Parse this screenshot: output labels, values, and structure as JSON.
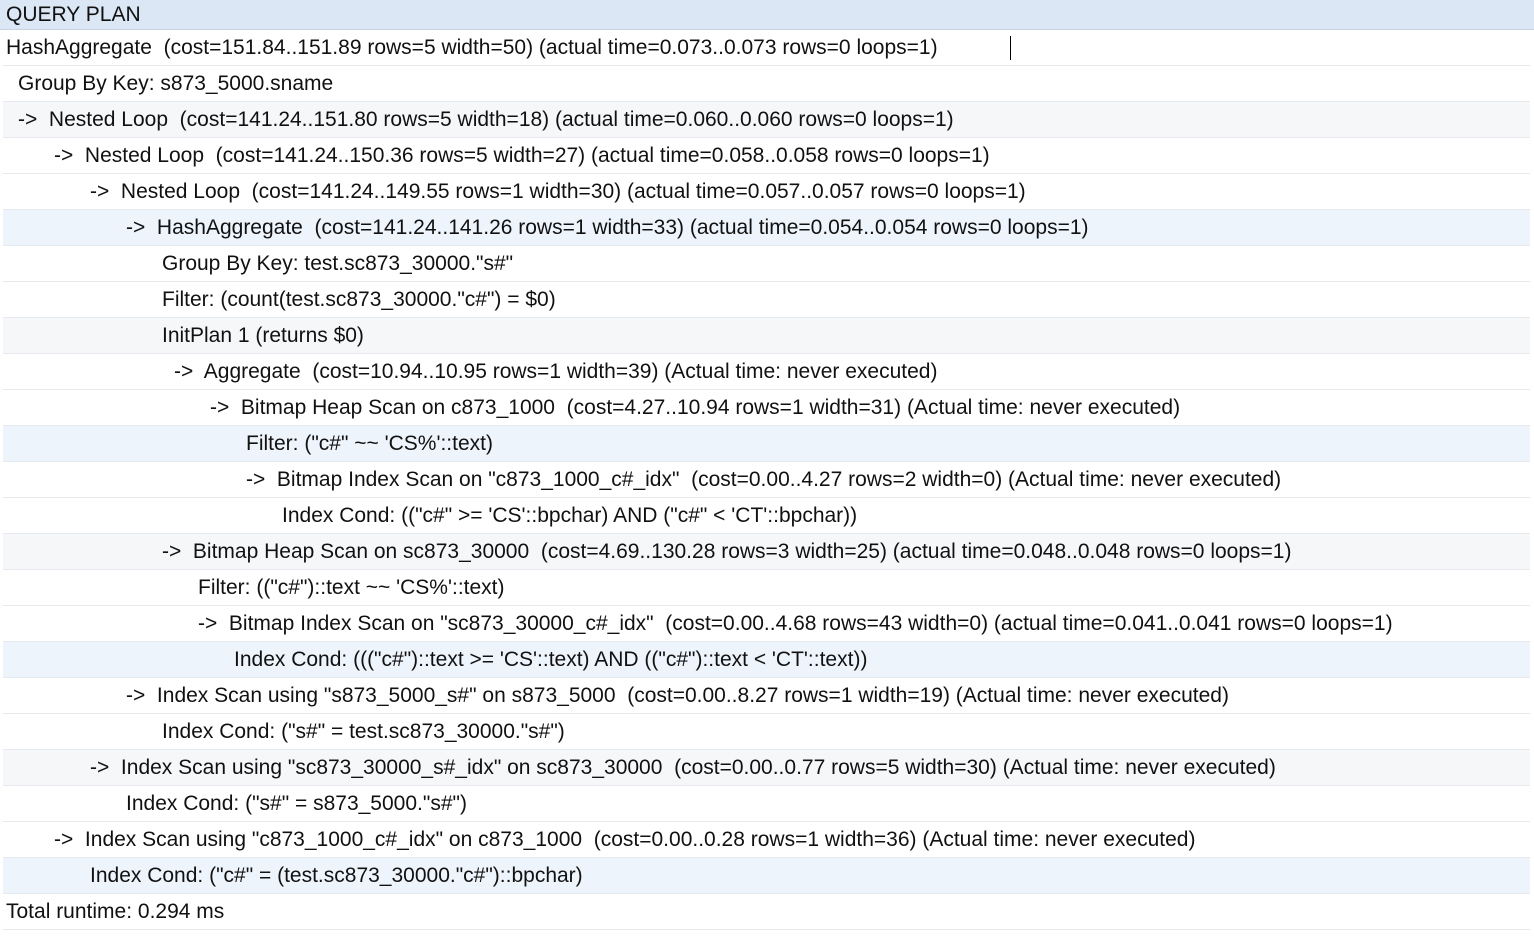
{
  "column_header": "QUERY PLAN",
  "rows": [
    "HashAggregate  (cost=151.84..151.89 rows=5 width=50) (actual time=0.073..0.073 rows=0 loops=1)",
    "Group By Key: s873_5000.sname",
    "->  Nested Loop  (cost=141.24..151.80 rows=5 width=18) (actual time=0.060..0.060 rows=0 loops=1)",
    "->  Nested Loop  (cost=141.24..150.36 rows=5 width=27) (actual time=0.058..0.058 rows=0 loops=1)",
    "->  Nested Loop  (cost=141.24..149.55 rows=1 width=30) (actual time=0.057..0.057 rows=0 loops=1)",
    "->  HashAggregate  (cost=141.24..141.26 rows=1 width=33) (actual time=0.054..0.054 rows=0 loops=1)",
    "Group By Key: test.sc873_30000.\"s#\"",
    "Filter: (count(test.sc873_30000.\"c#\") = $0)",
    "InitPlan 1 (returns $0)",
    "->  Aggregate  (cost=10.94..10.95 rows=1 width=39) (Actual time: never executed)",
    "->  Bitmap Heap Scan on c873_1000  (cost=4.27..10.94 rows=1 width=31) (Actual time: never executed)",
    "Filter: (\"c#\" ~~ 'CS%'::text)",
    "->  Bitmap Index Scan on \"c873_1000_c#_idx\"  (cost=0.00..4.27 rows=2 width=0) (Actual time: never executed)",
    "Index Cond: ((\"c#\" >= 'CS'::bpchar) AND (\"c#\" < 'CT'::bpchar))",
    "->  Bitmap Heap Scan on sc873_30000  (cost=4.69..130.28 rows=3 width=25) (actual time=0.048..0.048 rows=0 loops=1)",
    "Filter: ((\"c#\")::text ~~ 'CS%'::text)",
    "->  Bitmap Index Scan on \"sc873_30000_c#_idx\"  (cost=0.00..4.68 rows=43 width=0) (actual time=0.041..0.041 rows=0 loops=1)",
    "Index Cond: (((\"c#\")::text >= 'CS'::text) AND ((\"c#\")::text < 'CT'::text))",
    "->  Index Scan using \"s873_5000_s#\" on s873_5000  (cost=0.00..8.27 rows=1 width=19) (Actual time: never executed)",
    "Index Cond: (\"s#\" = test.sc873_30000.\"s#\")",
    "->  Index Scan using \"sc873_30000_s#_idx\" on sc873_30000  (cost=0.00..0.77 rows=5 width=30) (Actual time: never executed)",
    "Index Cond: (\"s#\" = s873_5000.\"s#\")",
    "->  Index Scan using \"c873_1000_c#_idx\" on c873_1000  (cost=0.00..0.28 rows=1 width=36) (Actual time: never executed)",
    "Index Cond: (\"c#\" = (test.sc873_30000.\"c#\")::bpchar)",
    "Total runtime: 0.294 ms"
  ]
}
